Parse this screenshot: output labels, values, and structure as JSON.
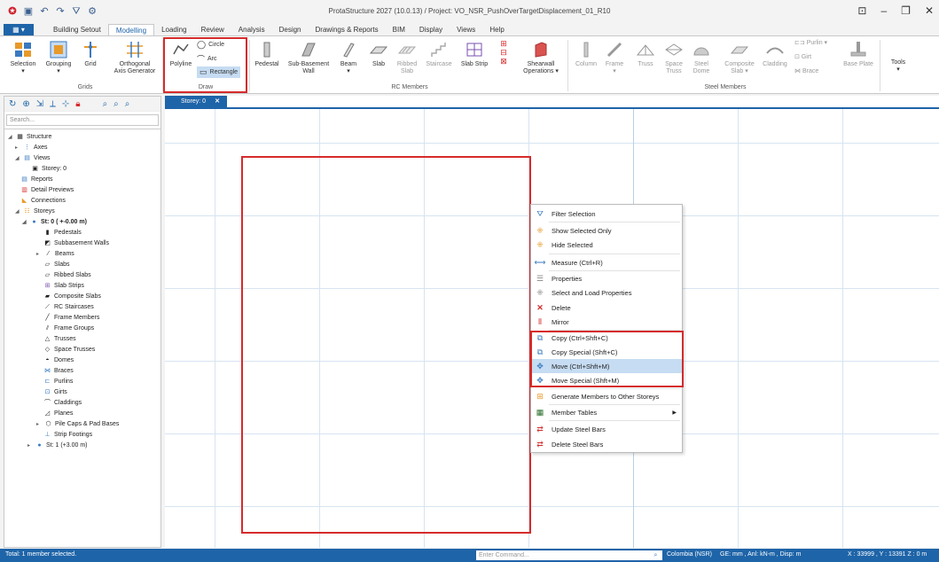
{
  "window": {
    "title": "ProtaStructure 2027 (10.0.13) / Project: VO_NSR_PushOverTargetDisplacement_01_R10"
  },
  "ribbon_tabs": [
    "Building Setout",
    "Modelling",
    "Loading",
    "Review",
    "Analysis",
    "Design",
    "Drawings & Reports",
    "BIM",
    "Display",
    "Views",
    "Help"
  ],
  "ribbon": {
    "buttons": {
      "selection": "Selection",
      "grouping": "Grouping",
      "grid": "Grid",
      "orthogonal_line1": "Orthogonal",
      "orthogonal_line2": "Axis Generator",
      "polyline": "Polyline",
      "circle": "Circle",
      "arc": "Arc",
      "rectangle": "Rectangle",
      "pedestal": "Pedestal",
      "subbasement_line1": "Sub-Basement",
      "subbasement_line2": "Wall",
      "beam": "Beam",
      "slab": "Slab",
      "ribbed_line1": "Ribbed",
      "ribbed_line2": "Slab",
      "staircase": "Staircase",
      "slabstrip": "Slab Strip",
      "shearwall_line1": "Shearwall",
      "shearwall_line2": "Operations",
      "column": "Column",
      "frame": "Frame",
      "truss": "Truss",
      "spacetruss_line1": "Space",
      "spacetruss_line2": "Truss",
      "steeldome_line1": "Steel",
      "steeldome_line2": "Dome",
      "composite_line1": "Composite",
      "composite_line2": "Slab",
      "cladding": "Cladding",
      "purlin": "Purlin",
      "girt": "Girt",
      "brace": "Brace",
      "baseplate": "Base Plate",
      "tools": "Tools"
    },
    "groups": {
      "grids": "Grids",
      "draw": "Draw",
      "rc_members": "RC Members",
      "steel_members": "Steel Members"
    }
  },
  "left_panel": {
    "search_placeholder": "Search...",
    "tree": {
      "structure": "Structure",
      "axes": "Axes",
      "views": "Views",
      "storey0_view": "Storey: 0",
      "reports": "Reports",
      "detail_previews": "Detail Previews",
      "connections": "Connections",
      "storeys": "Storeys",
      "st0": "St: 0 ( +-0.00 m)",
      "pedestals": "Pedestals",
      "subbasement_walls": "Subbasement Walls",
      "beams": "Beams",
      "slabs": "Slabs",
      "ribbed_slabs": "Ribbed Slabs",
      "slab_strips": "Slab Strips",
      "composite_slabs": "Composite Slabs",
      "rc_staircases": "RC Staircases",
      "frame_members": "Frame Members",
      "frame_groups": "Frame Groups",
      "trusses": "Trusses",
      "space_trusses": "Space Trusses",
      "domes": "Domes",
      "braces": "Braces",
      "purlins": "Purlins",
      "girts": "Girts",
      "claddings": "Claddings",
      "planes": "Planes",
      "pile_caps": "Pile Caps & Pad Bases",
      "strip_footings": "Strip Footings",
      "st1": "St: 1 (+3.00 m)"
    }
  },
  "document_tab": "Storey: 0",
  "context_menu": {
    "filter_selection": "Filter Selection",
    "show_selected_only": "Show Selected Only",
    "hide_selected": "Hide Selected",
    "measure": "Measure (Ctrl+R)",
    "properties": "Properties",
    "select_load_properties": "Select and Load Properties",
    "delete": "Delete",
    "mirror": "Mirror",
    "copy": "Copy (Ctrl+Shft+C)",
    "copy_special": "Copy Special (Shft+C)",
    "move": "Move (Ctrl+Shft+M)",
    "move_special": "Move Special (Shft+M)",
    "generate_members": "Generate Members to Other Storeys",
    "member_tables": "Member Tables",
    "update_steel_bars": "Update Steel Bars",
    "delete_steel_bars": "Delete Steel Bars"
  },
  "status_bar": {
    "selection_info": "Total: 1 member selected.",
    "command_placeholder": "Enter Command...",
    "code": "Colombia (NSR)",
    "units": "GE: mm , Anl: kN-m , Disp: m",
    "coords": "X : 33999 , Y : 13391   Z : 0 m"
  },
  "colors": {
    "accent": "#1e64a8",
    "highlight": "#c6dcf2",
    "annotation_red": "#d62b2b"
  }
}
